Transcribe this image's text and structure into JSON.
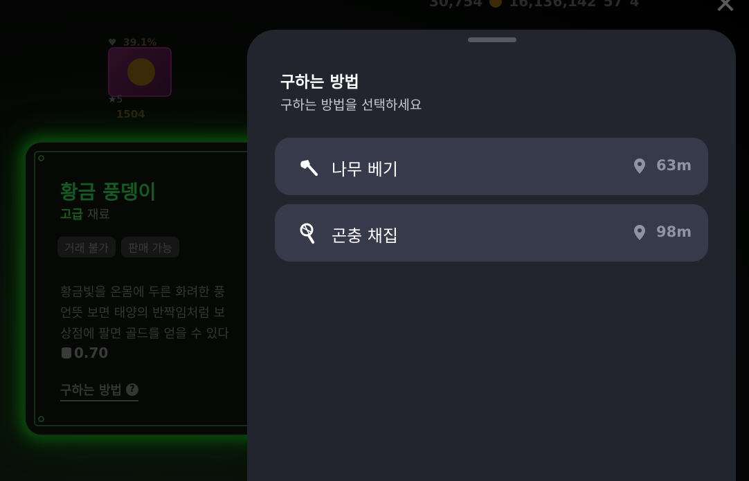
{
  "background": {
    "top_hud": [
      "30,754",
      "16,136,142",
      "57",
      "4"
    ],
    "character": {
      "percent": "39.1%",
      "stars": "★5",
      "power": "1504"
    },
    "item_card": {
      "name": "황금 풍뎅이",
      "grade": "고급",
      "category": "재료",
      "tags": [
        "거래 불가",
        "판매 가능"
      ],
      "description": [
        "황금빛을 온몸에 두른 화려한 풍",
        "언뜻 보면 태양의 반짝임처럼 보",
        "상점에 팔면 골드를 얻을 수 있다"
      ],
      "weight": "0.70",
      "howto_link": "구하는 방법",
      "howto_help": "?"
    },
    "close_icon": "✕"
  },
  "sheet": {
    "title": "구하는 방법",
    "subtitle": "구하는 방법을 선택하세요",
    "options": [
      {
        "icon": "axe-icon",
        "label": "나무 베기",
        "distance": "63m"
      },
      {
        "icon": "bug-net-icon",
        "label": "곤충 채집",
        "distance": "98m"
      }
    ]
  },
  "colors": {
    "sheet_bg": "#22252e",
    "option_bg": "#373a4a",
    "distance_text": "#8f93a3",
    "card_glow": "#0d4d0d"
  }
}
